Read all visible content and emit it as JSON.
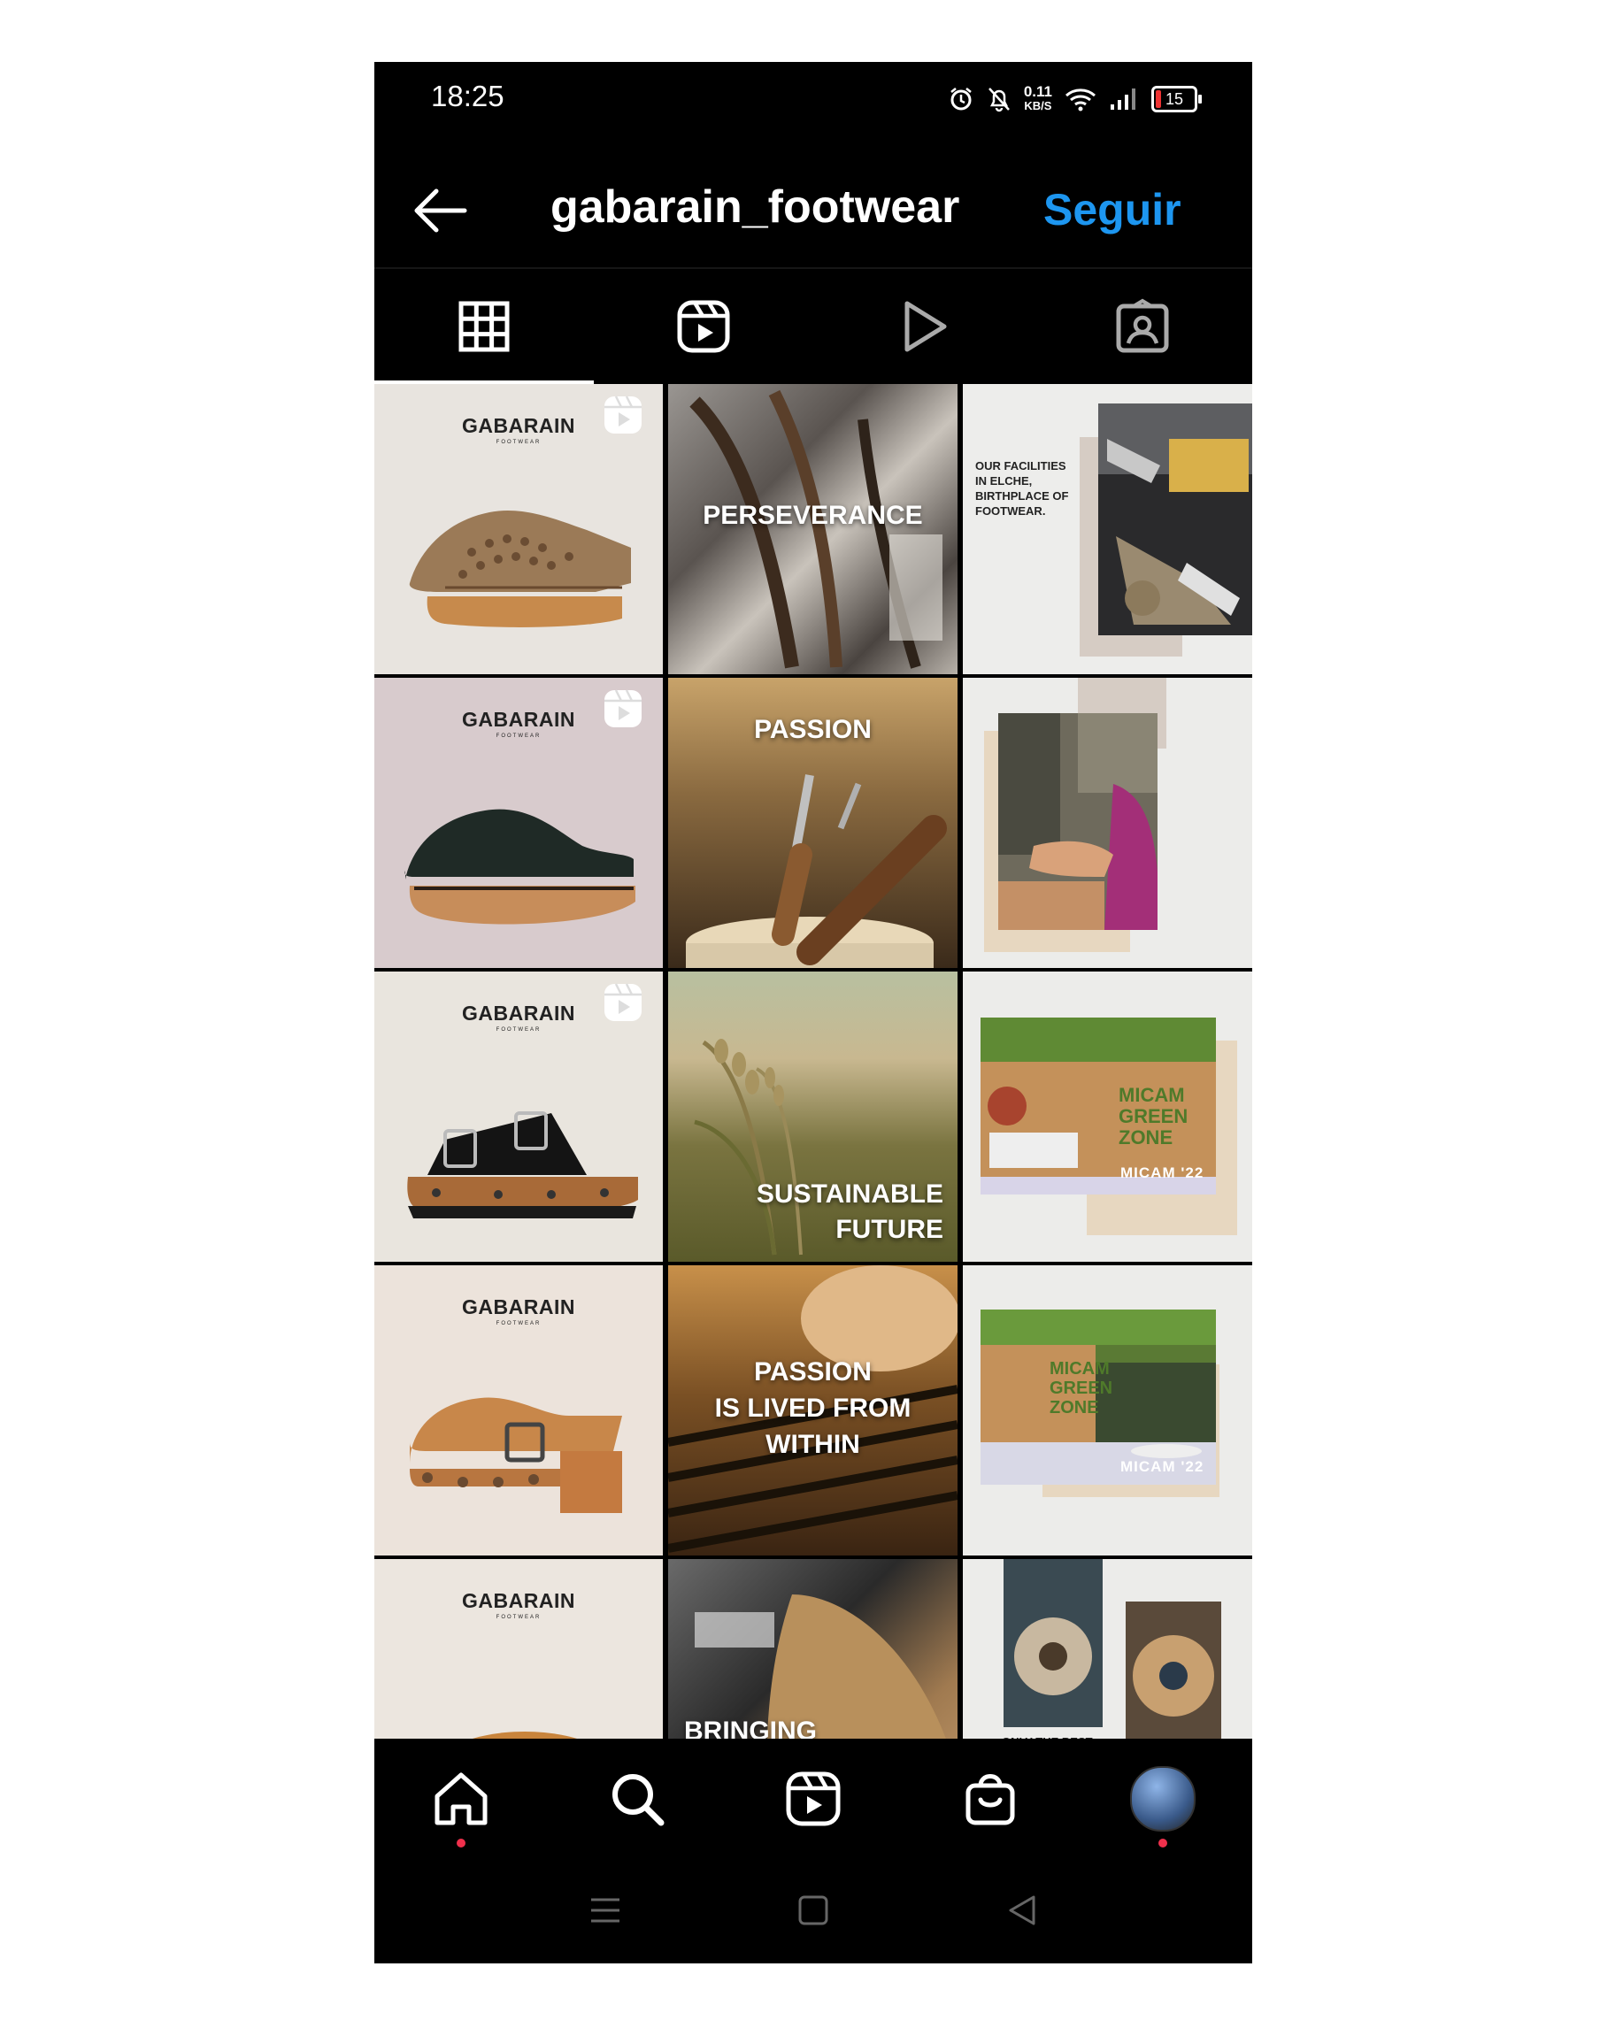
{
  "status_bar": {
    "time": "18:25",
    "speed_value": "0.11",
    "speed_unit": "KB/S",
    "battery": "15",
    "icons": [
      "alarm-icon",
      "mute-bell-icon",
      "wifi-icon",
      "signal-icon",
      "battery-icon"
    ]
  },
  "header": {
    "username": "gabarain_footwear",
    "follow_label": "Seguir",
    "follow_color": "#1d96f0"
  },
  "tabs": [
    {
      "name": "grid-tab-icon",
      "active": true
    },
    {
      "name": "reels-tab-icon",
      "active": false
    },
    {
      "name": "videos-tab-icon",
      "active": false
    },
    {
      "name": "tagged-tab-icon",
      "active": false
    }
  ],
  "posts": {
    "brand": "GABARAIN",
    "brand_sub": "FOOTWEAR",
    "p2_text": "PERSEVERANCE",
    "p3_text": "OUR FACILITIES IN ELCHE, BIRTHPLACE OF FOOTWEAR.",
    "p5_text": "PASSION",
    "p8_text_1": "SUSTAINABLE",
    "p8_text_2": "FUTURE",
    "p9_sign": "MICAM GREEN ZONE",
    "p9_text": "MICAM '22",
    "p11_text_1": "PASSION",
    "p11_text_2": "IS LIVED FROM",
    "p11_text_3": "WITHIN",
    "p12_sign": "MICAM GREEN ZONE",
    "p12_text": "MICAM '22",
    "p14_text": "BRINGING",
    "p15_text": "ONLY THE BEST"
  },
  "bottom_nav": {
    "items": [
      "home-icon",
      "search-icon",
      "reels-icon",
      "shop-icon",
      "profile-avatar"
    ],
    "notification_color": "#f0304c"
  }
}
